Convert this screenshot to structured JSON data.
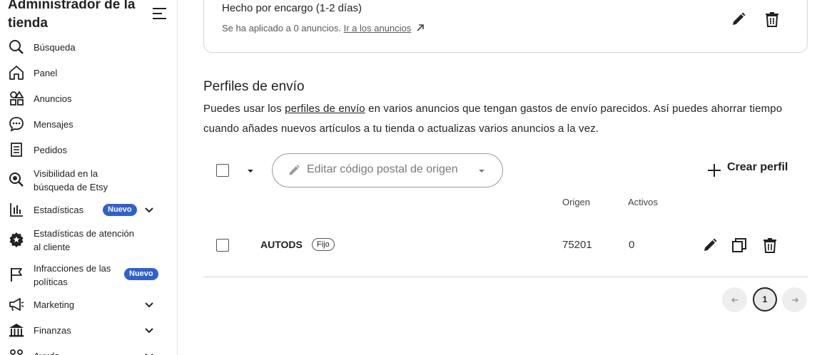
{
  "sidebar": {
    "title": "Administrador de la tienda",
    "items": [
      {
        "label": "Búsqueda",
        "icon": "search-icon"
      },
      {
        "label": "Panel",
        "icon": "home-icon"
      },
      {
        "label": "Anuncios",
        "icon": "shapes-icon"
      },
      {
        "label": "Mensajes",
        "icon": "chat-icon"
      },
      {
        "label": "Pedidos",
        "icon": "receipt-icon"
      },
      {
        "label": "Visibilidad en la búsqueda de Etsy",
        "icon": "search-visibility-icon"
      },
      {
        "label": "Estadísticas",
        "icon": "bar-chart-icon",
        "badge": "Nuevo"
      },
      {
        "label": "Estadísticas de atención al cliente",
        "icon": "star-badge-icon"
      },
      {
        "label": "Infracciones de las políticas",
        "icon": "flag-icon",
        "badge": "Nuevo"
      },
      {
        "label": "Marketing",
        "icon": "megaphone-icon"
      },
      {
        "label": "Finanzas",
        "icon": "bank-icon"
      },
      {
        "label": "Ayuda",
        "icon": "help-icon"
      }
    ]
  },
  "card": {
    "title": "Hecho por encargo (1-2 días)",
    "applied_text": "Se ha aplicado a 0 anuncios.",
    "link_text": "Ir a los anuncios"
  },
  "shipping": {
    "title": "Perfiles de envío",
    "desc_before": "Puedes usar los ",
    "desc_link": "perfiles de envío",
    "desc_after": " en varios anuncios que tengan gastos de envío parecidos. Así puedes ahorrar tiempo cuando añades nuevos artículos a tu tienda o actualizas varios anuncios a la vez.",
    "edit_zip_label": "Editar código postal de origen",
    "create_label": "Crear perfil",
    "columns": {
      "origin": "Origen",
      "active": "Activos"
    },
    "rows": [
      {
        "name": "AUTODS",
        "tag": "Fijo",
        "origin": "75201",
        "active": "0"
      }
    ]
  },
  "pagination": {
    "current": "1"
  }
}
